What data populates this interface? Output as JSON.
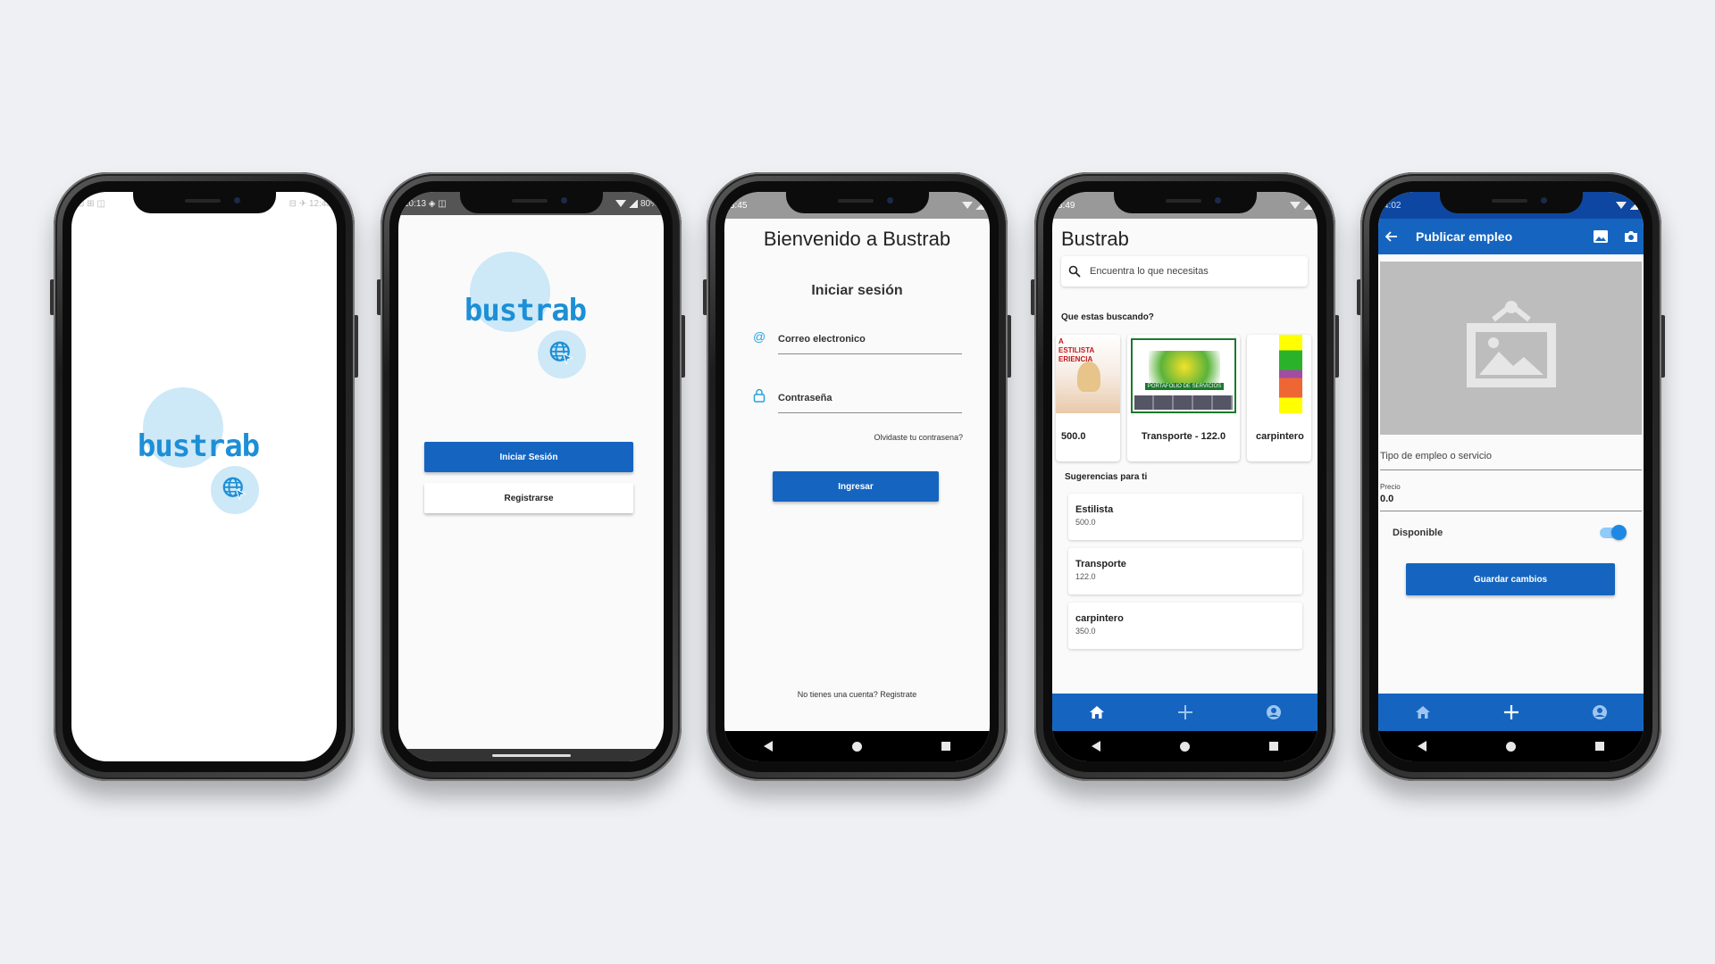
{
  "brand": {
    "logo_text": "bustrab",
    "accent": "#1565c0",
    "logo_blue": "#1d8fd6"
  },
  "screens": [
    {
      "status": {
        "left": "⊡ ⊞ ◫",
        "right": "⊟ ✈ 12:43"
      }
    },
    {
      "status": {
        "left": "10:13 ◈ ◫",
        "right": "80%"
      },
      "login_button": "Iniciar Sesión",
      "register_button": "Registrarse"
    },
    {
      "status": {
        "left": "3:45",
        "right": ""
      },
      "title": "Bienvenido a Bustrab",
      "subtitle": "Iniciar sesión",
      "email_placeholder": "Correo electronico",
      "password_placeholder": "Contraseña",
      "forgot_link": "Olvidaste tu contrasena?",
      "submit_button": "Ingresar",
      "signup_text": "No tienes una cuenta? Registrate"
    },
    {
      "status": {
        "left": "3:49",
        "right": ""
      },
      "title": "Bustrab",
      "search_placeholder": "Encuentra lo que necesitas",
      "section_search": "Que estas buscando?",
      "cards": [
        {
          "label": "500.0",
          "image_text": "A ESTILISTA ERIENCIA"
        },
        {
          "label": "Transporte - 122.0",
          "image_text": "PORTAFOLIO DE SERVICIOS"
        },
        {
          "label": "carpintero"
        }
      ],
      "section_suggestions": "Sugerencias para ti",
      "suggestions": [
        {
          "title": "Estilista",
          "price": "500.0"
        },
        {
          "title": "Transporte",
          "price": "122.0"
        },
        {
          "title": "carpintero",
          "price": "350.0"
        }
      ]
    },
    {
      "status": {
        "left": "4:02",
        "right": ""
      },
      "title": "Publicar empleo",
      "type_label": "Tipo de empleo o servicio",
      "price_label": "Precio",
      "price_value": "0.0",
      "available_label": "Disponible",
      "available_value": true,
      "save_button": "Guardar cambios"
    }
  ]
}
